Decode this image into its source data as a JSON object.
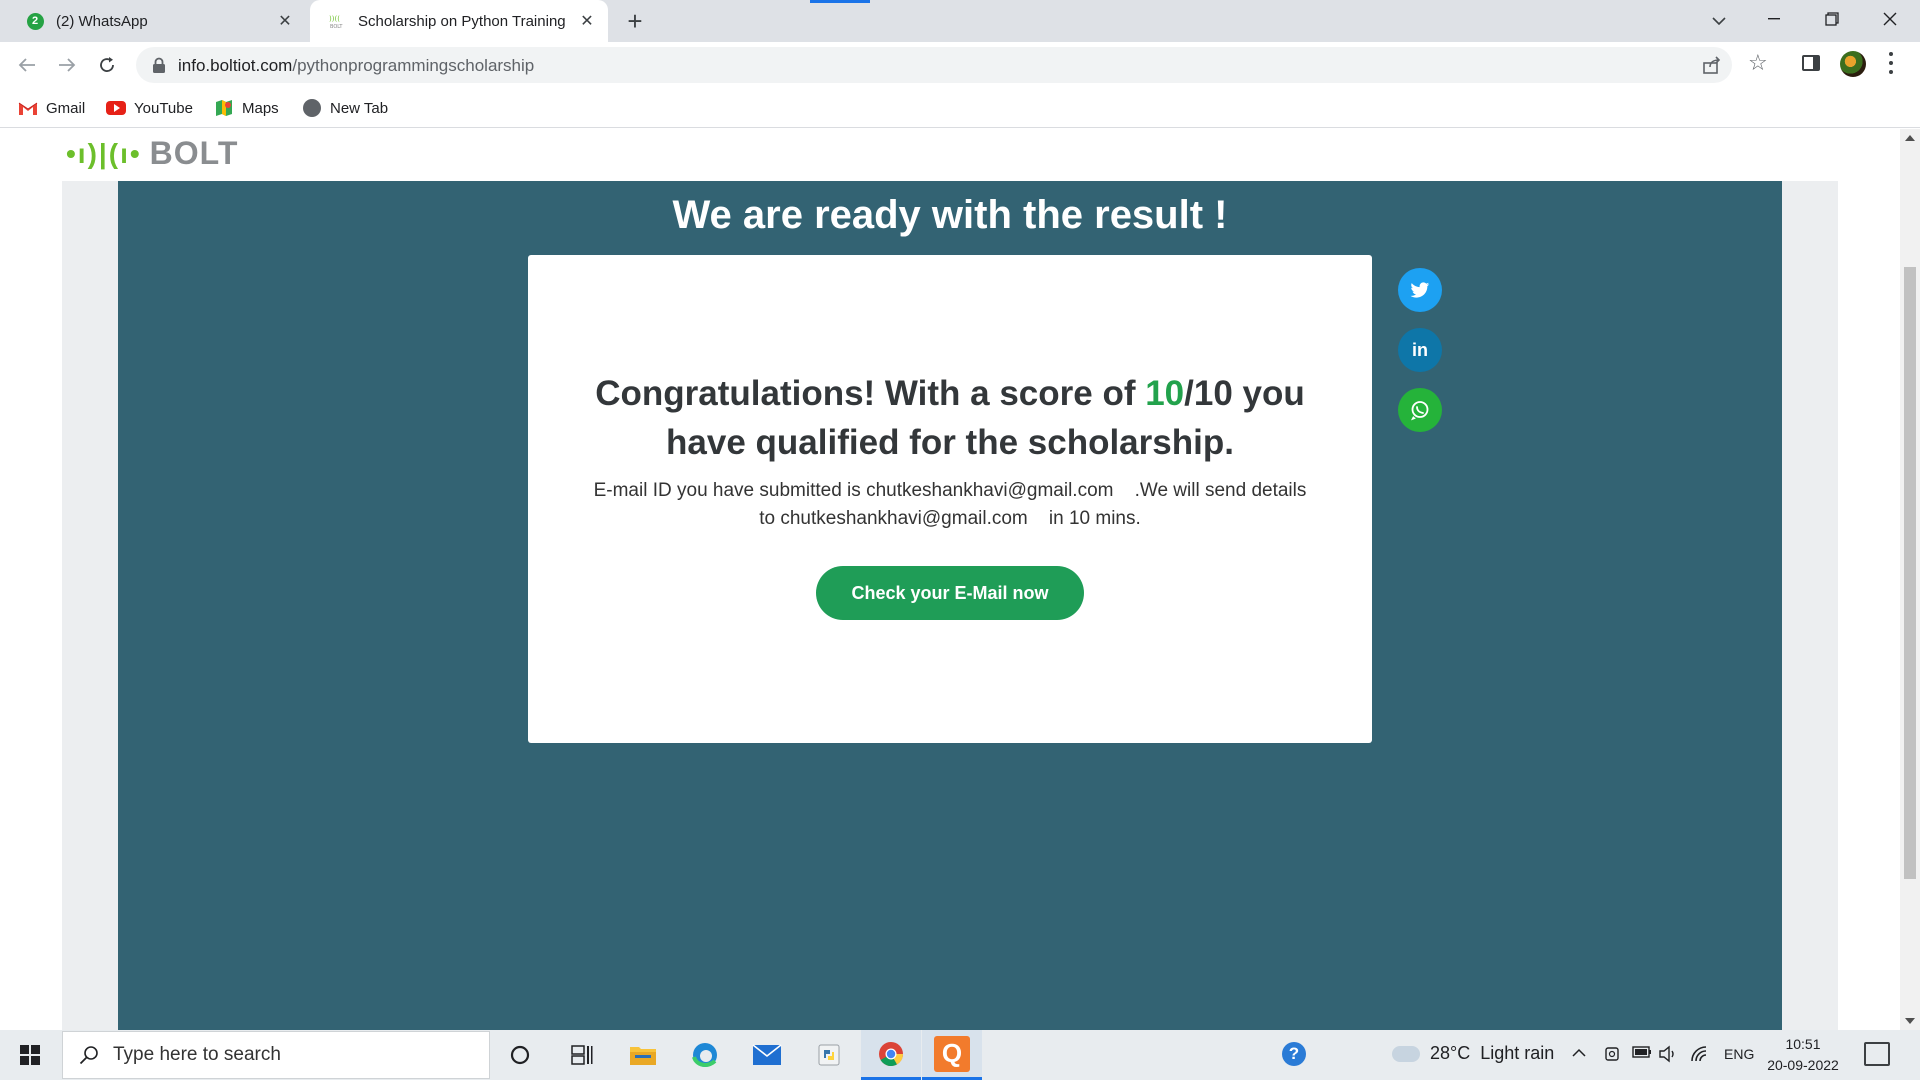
{
  "browser": {
    "tabs": [
      {
        "badge": "2",
        "title": "(2) WhatsApp"
      },
      {
        "title": "Scholarship on Python Training",
        "favicon_text": "BOLT"
      }
    ],
    "url_domain": "info.boltiot.com",
    "url_path": "/pythonprogrammingscholarship",
    "bookmarks": [
      {
        "label": "Gmail",
        "icon": "gmail-icon"
      },
      {
        "label": "YouTube",
        "icon": "youtube-icon"
      },
      {
        "label": "Maps",
        "icon": "maps-icon"
      },
      {
        "label": "New Tab",
        "icon": "globe-icon"
      }
    ]
  },
  "page": {
    "logo_text": "BOLT",
    "heading": "We are ready with the result !",
    "congrats_prefix": "Congratulations! With a score of ",
    "score": "10",
    "score_total": "/10",
    "congrats_suffix": " you have qualified for the scholarship.",
    "email_line1_prefix": "E-mail ID you have submitted is ",
    "email": "chutkeshankhavi@gmail.com",
    "email_line1_suffix": "    .We will send details",
    "email_line2_prefix": "to ",
    "email_line2_suffix": "    in 10 mins.",
    "button_label": "Check your E-Mail now",
    "social": [
      "twitter-icon",
      "linkedin-icon",
      "whatsapp-icon"
    ],
    "linkedin_text": "in"
  },
  "taskbar": {
    "search_placeholder": "Type here to search",
    "weather_temp": "28°C",
    "weather_desc": "Light rain",
    "language": "ENG",
    "time": "10:51",
    "date": "20-09-2022",
    "q_app_letter": "Q"
  },
  "colors": {
    "content_bg": "#336373",
    "score_green": "#22a24c",
    "button_green": "#1f9d57",
    "logo_green": "#6cbf2b"
  }
}
